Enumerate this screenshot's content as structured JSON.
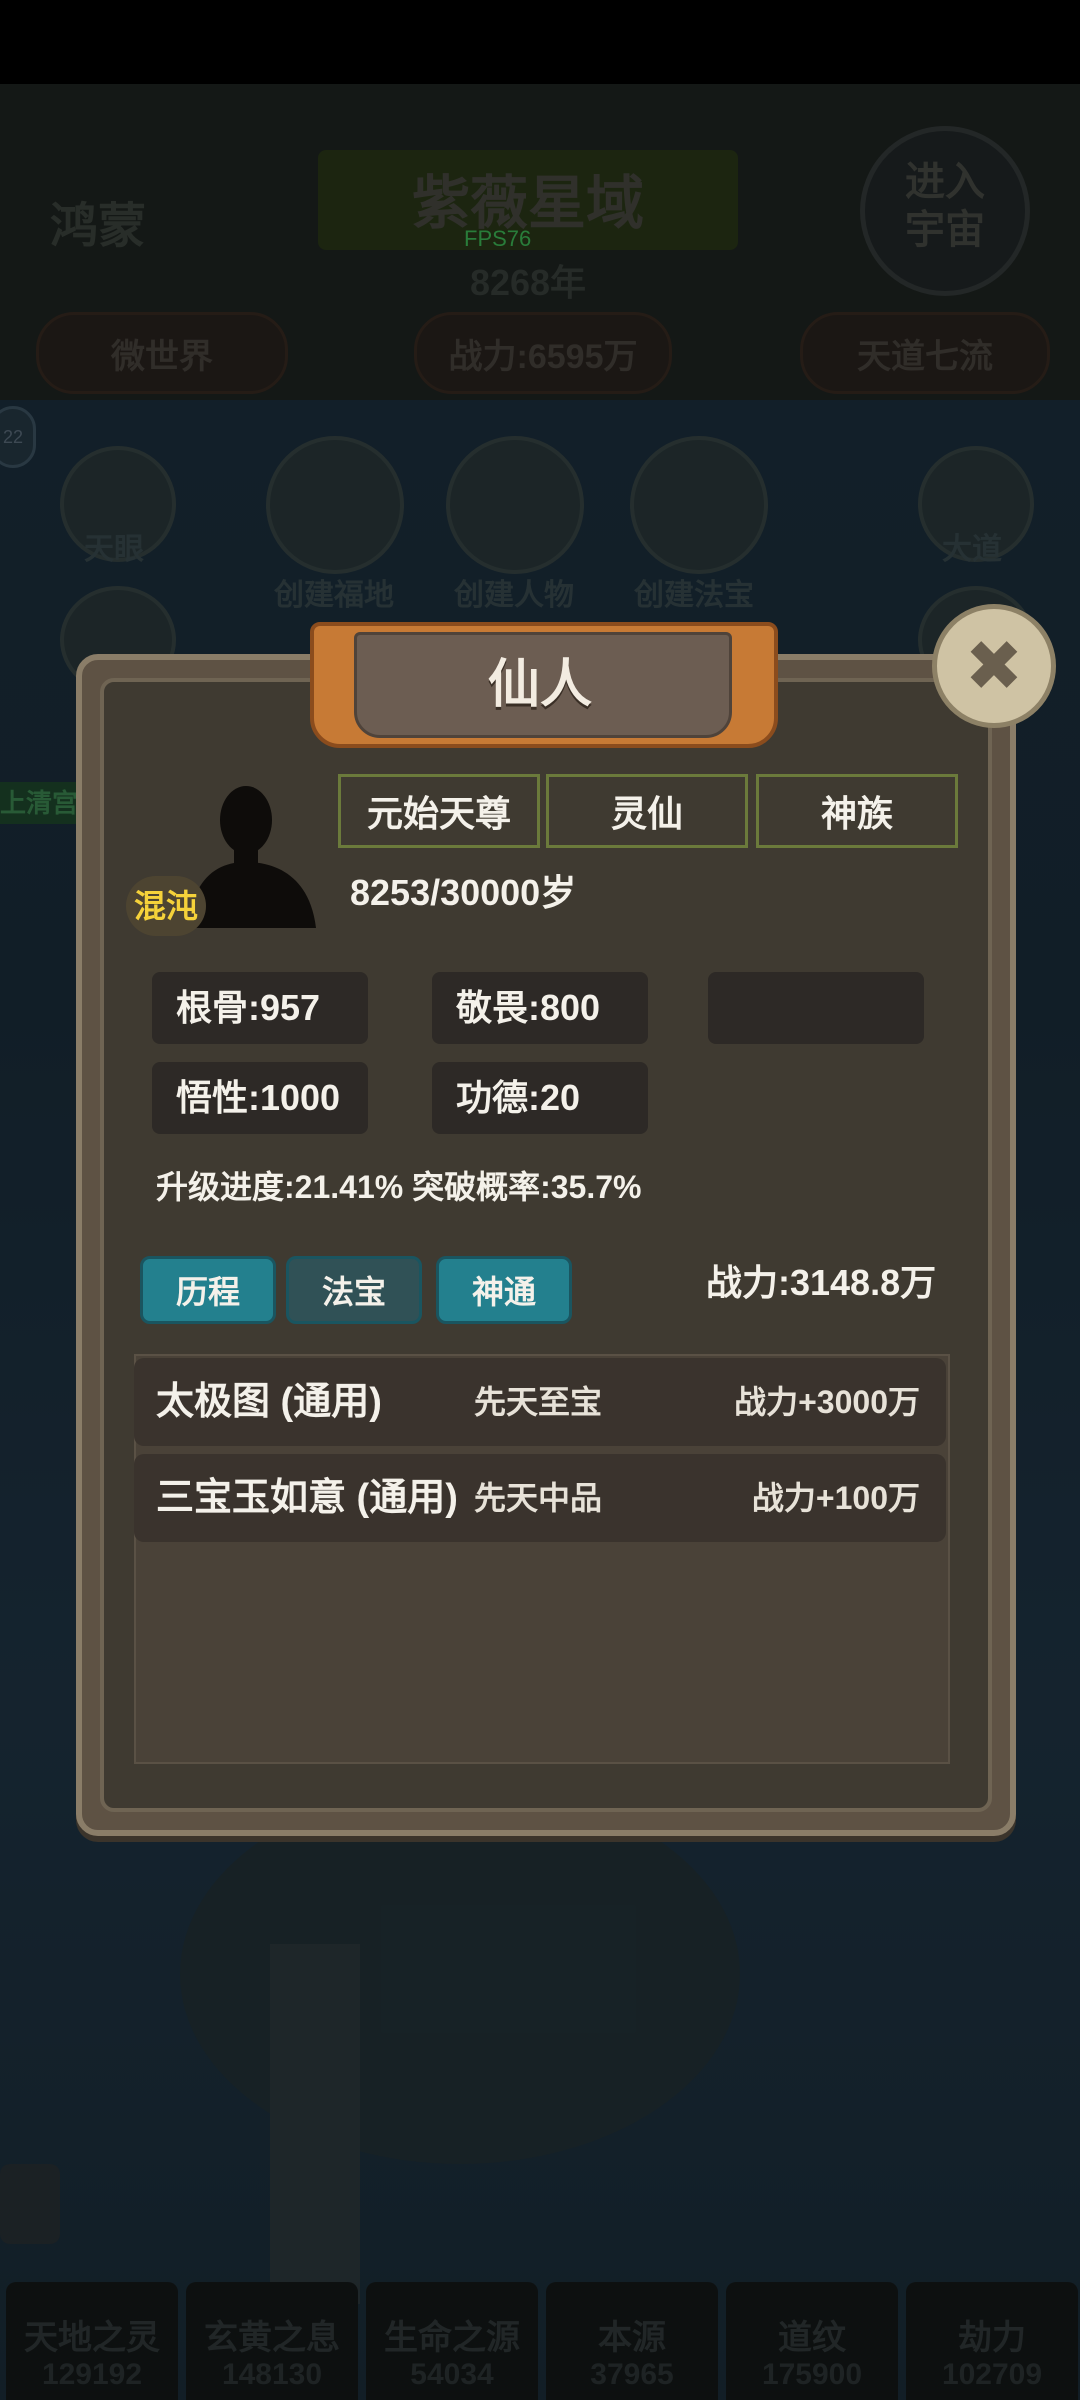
{
  "top": {
    "left_label": "鸿蒙",
    "region_title": "紫薇星域",
    "fps": "FPS76",
    "years": "8268年",
    "enter_button": "进入\n宇宙",
    "pill_left": "微世界",
    "pill_center": "战力:6595万",
    "pill_right": "天道七流",
    "mini_badge": "22"
  },
  "background_buttons": [
    "天眼",
    "创建福地",
    "创建人物",
    "创建法宝",
    "大道"
  ],
  "side_sign": "上清宫",
  "dialog": {
    "title": "仙人",
    "close_icon": "✖",
    "realm_badge": "混沌",
    "tags": [
      "元始天尊",
      "灵仙",
      "神族"
    ],
    "age": "8253/30000岁",
    "stats": {
      "gengu": "根骨:957",
      "jingwei": "敬畏:800",
      "wuxing": "悟性:1000",
      "gongde": "功德:20"
    },
    "progress_text": "升级进度:21.41% 突破概率:35.7%",
    "tabs": [
      "历程",
      "法宝",
      "神通"
    ],
    "power": "战力:3148.8万",
    "items": [
      {
        "name": "太极图 (通用)",
        "grade": "先天至宝",
        "power": "战力+3000万"
      },
      {
        "name": "三宝玉如意 (通用)",
        "grade": "先天中品",
        "power": "战力+100万"
      }
    ]
  },
  "resources": [
    {
      "name": "天地之灵",
      "value": "129192"
    },
    {
      "name": "玄黄之息",
      "value": "148130"
    },
    {
      "name": "生命之源",
      "value": "54034"
    },
    {
      "name": "本源",
      "value": "37965"
    },
    {
      "name": "道纹",
      "value": "175900"
    },
    {
      "name": "劫力",
      "value": "102709"
    }
  ],
  "colors": {
    "accent_tab": "#23808e",
    "realm_badge_text": "#f5d23a",
    "fps_text": "#3fbf5a"
  }
}
